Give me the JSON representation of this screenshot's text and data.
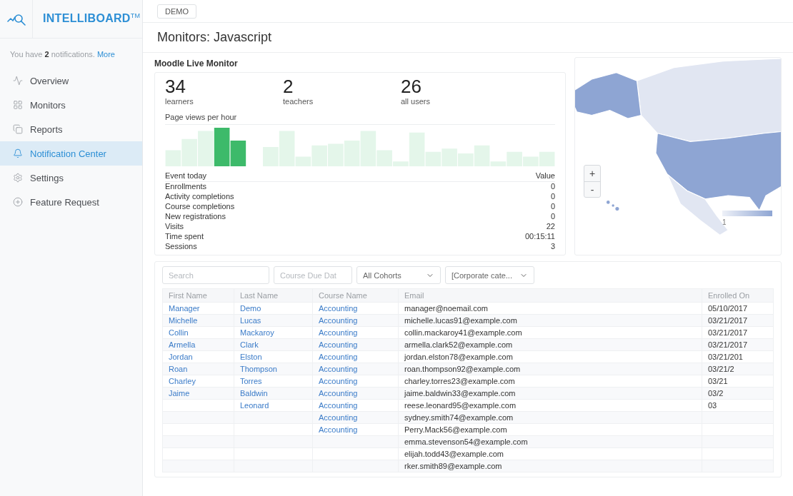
{
  "sidebar": {
    "logo": "INTELLIBOARD$^{TM}$",
    "notice": {
      "text": "You have **2** notifications.",
      "link": "More"
    },
    "items": [
      {
        "label": "Overview",
        "selected": false
      },
      {
        "label": "Monitors",
        "selected": false
      },
      {
        "label": "Reports",
        "selected": false
      },
      {
        "label": "Notification Center",
        "selected": true
      },
      {
        "label": "Settings",
        "selected": false
      },
      {
        "label": "Feature Request",
        "selected": false
      }
    ]
  },
  "topbar": {
    "tag": "DEMO"
  },
  "page_title": "Monitors: Javascript",
  "monitor": {
    "title": "Moodle Live Monitor",
    "stats": [
      {
        "value": "34",
        "label": "learners"
      },
      {
        "value": "2",
        "label": "teachers"
      },
      {
        "value": "26",
        "label": "all users"
      }
    ],
    "chart_title": "Page views per hour",
    "events": {
      "columns": [
        "Event today",
        "Value"
      ],
      "rows": [
        {
          "event": "Enrollments",
          "value": "0"
        },
        {
          "event": "Activity completions",
          "value": "0"
        },
        {
          "event": "Course completions",
          "value": "0"
        },
        {
          "event": "New registrations",
          "value": "0"
        },
        {
          "event": "Visits",
          "value": "22"
        },
        {
          "event": "Time spent",
          "value": "00:15:11"
        },
        {
          "event": "Sessions",
          "value": "3"
        }
      ]
    }
  },
  "map": {
    "zoom_in": "+",
    "zoom_out": "-",
    "legend_label": "1"
  },
  "table": {
    "filters": [
      {
        "kind": "search",
        "placeholder": "Search"
      },
      {
        "kind": "date",
        "placeholder": "Course Due Dat"
      },
      {
        "kind": "select",
        "value": "All Cohorts"
      },
      {
        "kind": "select",
        "value": "[Corporate cate..."
      }
    ],
    "columns": [
      "First Name",
      "Last Name",
      "Course Name",
      "Email",
      "Enrolled On"
    ],
    "rows": [
      {
        "first_name": "Manager",
        "last_name": "Demo",
        "course": "Accounting",
        "email": "manager@noemail.com",
        "enrolled_on": "05/10/2017"
      },
      {
        "first_name": "Michelle",
        "last_name": "Lucas",
        "course": "Accounting",
        "email": "michelle.lucas91@example.com",
        "enrolled_on": "03/21/2017"
      },
      {
        "first_name": "Collin",
        "last_name": "Mackaroy",
        "course": "Accounting",
        "email": "collin.mackaroy41@example.com",
        "enrolled_on": "03/21/2017"
      },
      {
        "first_name": "Armella",
        "last_name": "Clark",
        "course": "Accounting",
        "email": "armella.clark52@example.com",
        "enrolled_on": "03/21/2017"
      },
      {
        "first_name": "Jordan",
        "last_name": "Elston",
        "course": "Accounting",
        "email": "jordan.elston78@example.com",
        "enrolled_on": "03/21/201"
      },
      {
        "first_name": "Roan",
        "last_name": "Thompson",
        "course": "Accounting",
        "email": "roan.thompson92@example.com",
        "enrolled_on": "03/21/2"
      },
      {
        "first_name": "Charley",
        "last_name": "Torres",
        "course": "Accounting",
        "email": "charley.torres23@example.com",
        "enrolled_on": "03/21"
      },
      {
        "first_name": "Jaime",
        "last_name": "Baldwin",
        "course": "Accounting",
        "email": "jaime.baldwin33@example.com",
        "enrolled_on": "03/2"
      },
      {
        "last_name": "Leonard",
        "course": "Accounting",
        "email": "reese.leonard95@example.com",
        "enrolled_on": "03"
      },
      {
        "course": "Accounting",
        "email": "sydney.smith74@example.com"
      },
      {
        "course": "Accounting",
        "email": "Perry.Mack56@example.com"
      },
      {
        "email": "emma.stevenson54@example.com"
      },
      {
        "email": "elijah.todd43@example.com"
      },
      {
        "email": "rker.smith89@example.com"
      }
    ]
  }
}
